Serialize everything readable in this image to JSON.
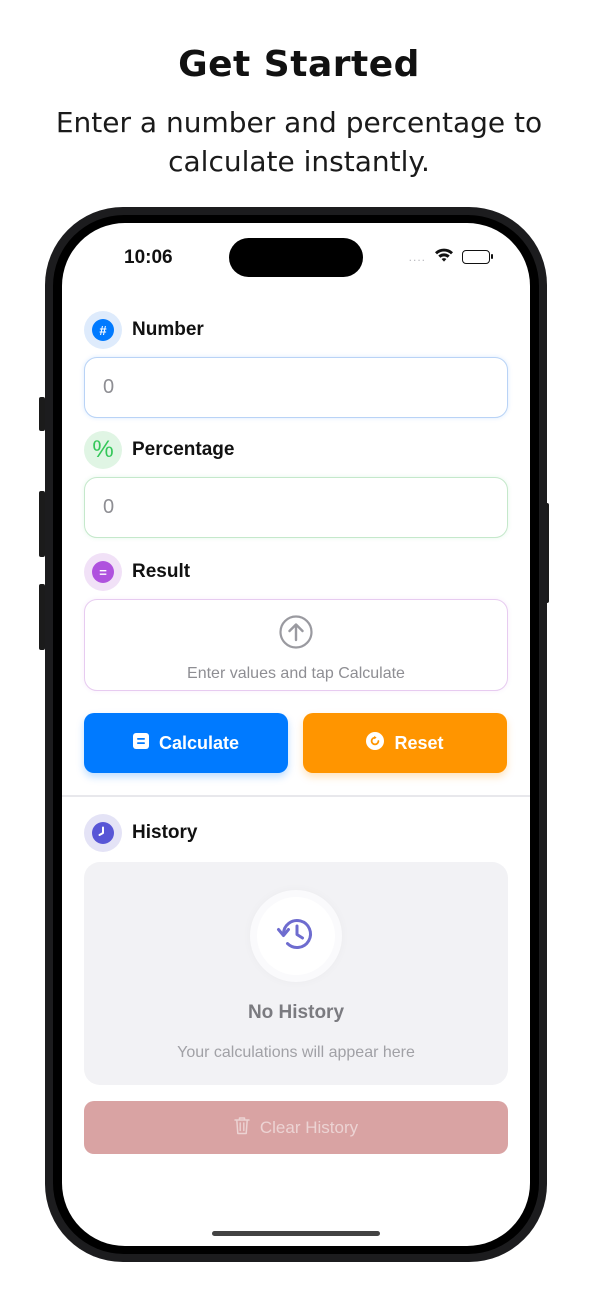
{
  "banner": {
    "title": "Get Started",
    "subtitle": "Enter a number and percentage to calculate instantly."
  },
  "status_bar": {
    "time": "10:06",
    "signal_dots": "....",
    "icons": [
      "wifi-icon",
      "battery-icon"
    ]
  },
  "form": {
    "number": {
      "label": "Number",
      "icon": "hash-icon",
      "glyph": "#",
      "value": "",
      "placeholder": "0",
      "accent": "#007aff"
    },
    "percentage": {
      "label": "Percentage",
      "icon": "percent-icon",
      "glyph": "%",
      "value": "",
      "placeholder": "0",
      "accent": "#34c759"
    },
    "result": {
      "label": "Result",
      "icon": "equals-icon",
      "glyph": "=",
      "hint": "Enter values and tap Calculate",
      "accent": "#af52de"
    }
  },
  "actions": {
    "calculate": {
      "label": "Calculate",
      "icon": "calculator-icon",
      "color": "#007aff"
    },
    "reset": {
      "label": "Reset",
      "icon": "reset-icon",
      "color": "#ff9500"
    }
  },
  "history": {
    "label": "History",
    "icon": "clock-icon",
    "accent": "#5856d6",
    "empty_title": "No History",
    "empty_subtitle": "Your calculations will appear here",
    "clear_label": "Clear History",
    "clear_enabled": false
  }
}
